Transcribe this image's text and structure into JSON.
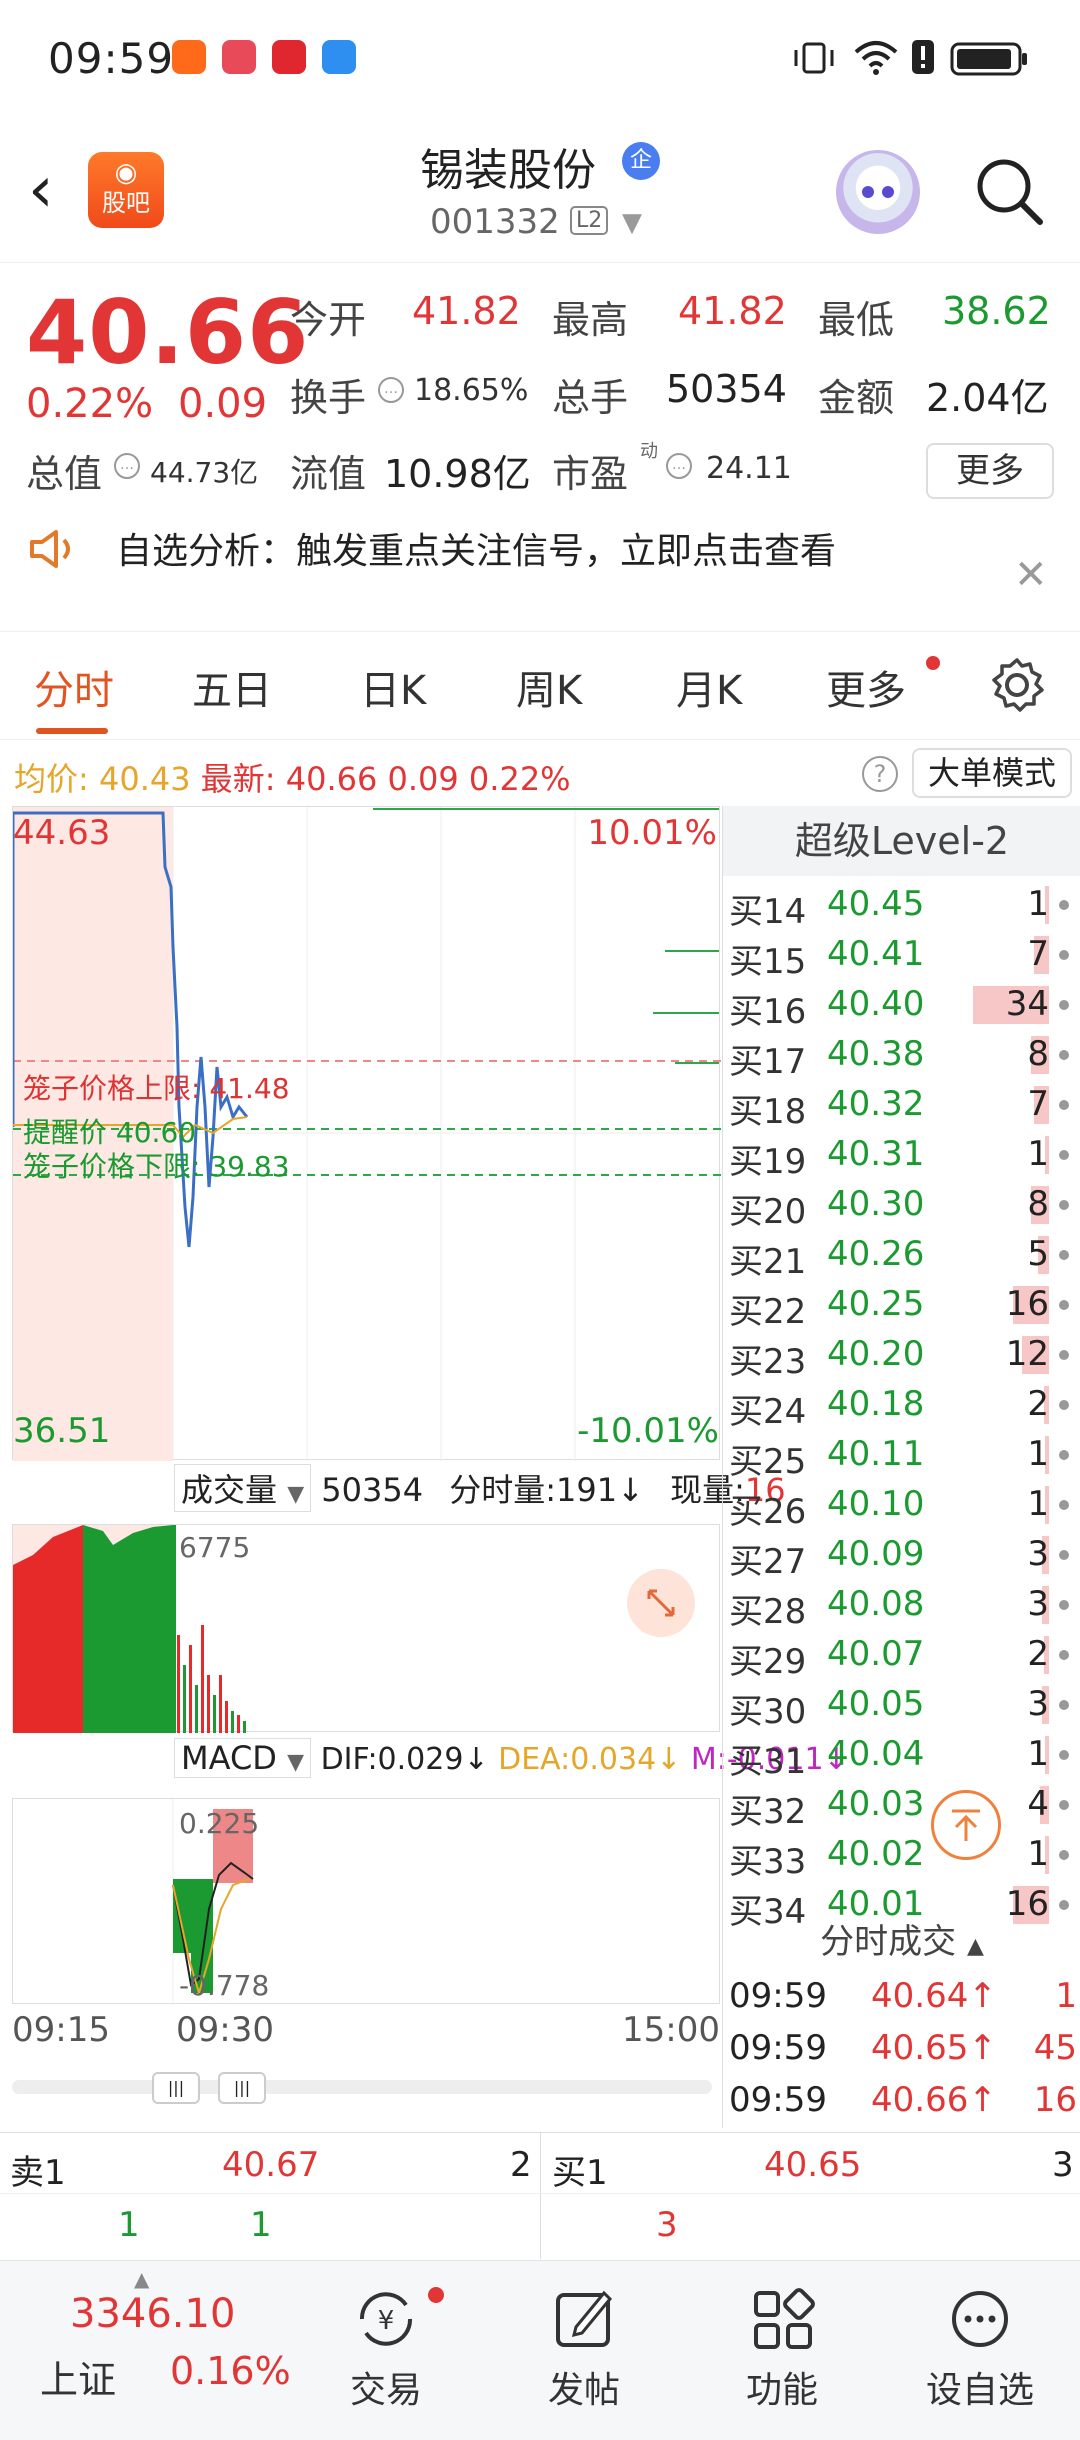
{
  "status_bar": {
    "time": "09:59",
    "app_icons": [
      "guba-app-icon",
      "huawei-app-icon",
      "red-app-icon",
      "weather-app-icon"
    ],
    "right_icons": [
      "vibrate-icon",
      "wifi-icon",
      "alert-icon",
      "battery-icon"
    ]
  },
  "header": {
    "guba_label": "股吧",
    "stock_name": "锡装股份",
    "badge": "企",
    "stock_code": "001332",
    "level_badge": "L2"
  },
  "quote": {
    "price": "40.66",
    "change_pct": "0.22%",
    "change": "0.09",
    "open_label": "今开",
    "open": "41.82",
    "high_label": "最高",
    "high": "41.82",
    "low_label": "最低",
    "low": "38.62",
    "turnover_label": "换手",
    "turnover": "18.65%",
    "volume_label": "总手",
    "volume": "50354",
    "amount_label": "金额",
    "amount": "2.04亿",
    "mktcap_label": "总值",
    "mktcap": "44.73亿",
    "float_label": "流值",
    "float": "10.98亿",
    "pe_label": "市盈",
    "pe_sup": "动",
    "pe": "24.11",
    "more_label": "更多"
  },
  "alert": {
    "text": "自选分析：触发重点关注信号，立即点击查看"
  },
  "tabs": [
    "分时",
    "五日",
    "日K",
    "周K",
    "月K",
    "更多"
  ],
  "avg_row": {
    "avg_label": "均价:",
    "avg": "40.43",
    "latest_label": "最新:",
    "latest": "40.66",
    "change": "0.09",
    "change_pct": "0.22%",
    "big_order_label": "大单模式"
  },
  "chart": {
    "y_top": "44.63",
    "y_bottom": "36.51",
    "pct_top": "10.01%",
    "pct_bottom": "-10.01%",
    "cage_upper_label": "笼子价格上限:",
    "cage_upper": "41.48",
    "remind_label": "提醒价",
    "remind": "40.60",
    "cage_lower_label": "笼子价格下限:",
    "cage_lower": "39.83",
    "colors": {
      "price_line": "#3a6fc4",
      "avg_line": "#e5a62a",
      "cage_line": "#e88",
      "remind_line": "#2aa84a"
    }
  },
  "volume": {
    "label": "成交量",
    "total": "50354",
    "fenshi_label": "分时量:",
    "fenshi_val": "191",
    "now_label": "现量:",
    "now_val": "16",
    "max": "6775"
  },
  "macd": {
    "label": "MACD",
    "dif": "DIF:0.029",
    "dea": "DEA:0.034",
    "m": "M:-0.011",
    "top": "0.225",
    "bottom": "-0.778"
  },
  "x_axis": {
    "start": "09:15",
    "mid": "09:30",
    "end": "15:00"
  },
  "level2": {
    "title": "超级Level-2",
    "bids": [
      {
        "label": "买14",
        "price": "40.45",
        "qty": "1",
        "bar": 0.03
      },
      {
        "label": "买15",
        "price": "40.41",
        "qty": "7",
        "bar": 0.2
      },
      {
        "label": "买16",
        "price": "40.40",
        "qty": "34",
        "bar": 1.0
      },
      {
        "label": "买17",
        "price": "40.38",
        "qty": "8",
        "bar": 0.24
      },
      {
        "label": "买18",
        "price": "40.32",
        "qty": "7",
        "bar": 0.2
      },
      {
        "label": "买19",
        "price": "40.31",
        "qty": "1",
        "bar": 0.03
      },
      {
        "label": "买20",
        "price": "40.30",
        "qty": "8",
        "bar": 0.24
      },
      {
        "label": "买21",
        "price": "40.26",
        "qty": "5",
        "bar": 0.15
      },
      {
        "label": "买22",
        "price": "40.25",
        "qty": "16",
        "bar": 0.47
      },
      {
        "label": "买23",
        "price": "40.20",
        "qty": "12",
        "bar": 0.35
      },
      {
        "label": "买24",
        "price": "40.18",
        "qty": "2",
        "bar": 0.06
      },
      {
        "label": "买25",
        "price": "40.11",
        "qty": "1",
        "bar": 0.03
      },
      {
        "label": "买26",
        "price": "40.10",
        "qty": "1",
        "bar": 0.03
      },
      {
        "label": "买27",
        "price": "40.09",
        "qty": "3",
        "bar": 0.09
      },
      {
        "label": "买28",
        "price": "40.08",
        "qty": "3",
        "bar": 0.09
      },
      {
        "label": "买29",
        "price": "40.07",
        "qty": "2",
        "bar": 0.06
      },
      {
        "label": "买30",
        "price": "40.05",
        "qty": "3",
        "bar": 0.09
      },
      {
        "label": "买31",
        "price": "40.04",
        "qty": "1",
        "bar": 0.03
      },
      {
        "label": "买32",
        "price": "40.03",
        "qty": "4",
        "bar": 0.12
      },
      {
        "label": "买33",
        "price": "40.02",
        "qty": "1",
        "bar": 0.03
      },
      {
        "label": "买34",
        "price": "40.01",
        "qty": "16",
        "bar": 0.47
      }
    ],
    "fenshi_title": "分时成交",
    "trades": [
      {
        "time": "09:59",
        "price": "40.64↑",
        "vol": "1"
      },
      {
        "time": "09:59",
        "price": "40.65↑",
        "vol": "45"
      },
      {
        "time": "09:59",
        "price": "40.66↑",
        "vol": "16"
      }
    ]
  },
  "book": {
    "sell1_label": "卖1",
    "sell1_price": "40.67",
    "sell1_qty": "2",
    "sell1_sub_a": "1",
    "sell1_sub_b": "1",
    "buy1_label": "买1",
    "buy1_price": "40.65",
    "buy1_qty": "3",
    "buy1_sub": "3"
  },
  "bottom_nav": {
    "index_value": "3346.10",
    "index_name": "上证",
    "index_pct": "0.16%",
    "trade": "交易",
    "post": "发帖",
    "functions": "功能",
    "set_fav": "设自选"
  }
}
